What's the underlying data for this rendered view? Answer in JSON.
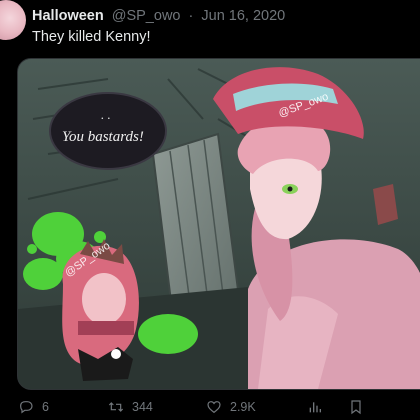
{
  "tweet": {
    "display_name": "Halloween",
    "handle": "@SP_owo",
    "separator": "·",
    "date": "Jun 16, 2020",
    "text": "They killed Kenny!"
  },
  "media": {
    "speech_bubble_dots": ". .",
    "speech_bubble_text": "You bastards!",
    "watermark_1": "@SP_owo",
    "watermark_2": "@SP_owo"
  },
  "actions": {
    "reply_icon": "reply-icon",
    "reply_count": "6",
    "retweet_icon": "retweet-icon",
    "retweet_count": "344",
    "like_icon": "heart-icon",
    "like_count": "2.9K",
    "views_icon": "views-icon",
    "bookmark_icon": "bookmark-icon"
  },
  "colors": {
    "background": "#000000",
    "text_primary": "#e7e9ea",
    "text_secondary": "#71767b"
  }
}
